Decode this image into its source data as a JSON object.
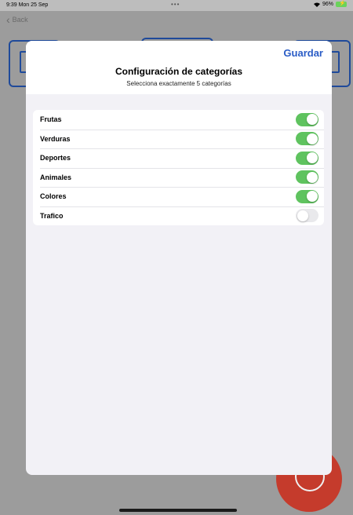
{
  "status_bar": {
    "time": "9:39  Mon 25 Sep",
    "dots": "•••",
    "battery": "96%"
  },
  "background": {
    "back_label": "Back"
  },
  "modal": {
    "save_label": "Guardar",
    "title": "Configuración de categorías",
    "subtitle": "Selecciona exactamente 5 categorías",
    "categories": [
      {
        "label": "Frutas",
        "enabled": true
      },
      {
        "label": "Verduras",
        "enabled": true
      },
      {
        "label": "Deportes",
        "enabled": true
      },
      {
        "label": "Animales",
        "enabled": true
      },
      {
        "label": "Colores",
        "enabled": true
      },
      {
        "label": "Trafico",
        "enabled": false
      }
    ]
  },
  "colors": {
    "accent": "#2a5cc6",
    "toggle_on": "#5fc35f",
    "toggle_off": "#e9e9ec",
    "fab": "#c53b2c"
  }
}
